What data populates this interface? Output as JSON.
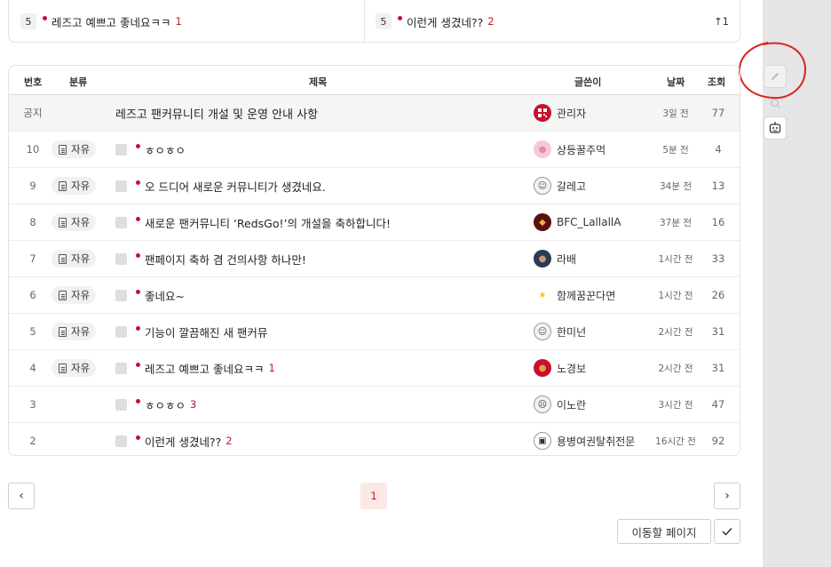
{
  "popular": {
    "left": {
      "rank": "5",
      "title": "레즈고 예쁘고 좋네요ㅋㅋ",
      "comments": "1"
    },
    "right": {
      "rank": "5",
      "title": "이런게 생겼네??",
      "comments": "2",
      "up_icon": "up-arrow-icon",
      "up_count": "↑1"
    }
  },
  "board": {
    "headers": {
      "num": "번호",
      "category": "분류",
      "title": "제목",
      "author": "글쓴이",
      "date": "날짜",
      "views": "조회"
    },
    "notice": {
      "label": "공지",
      "title": "레즈고 팬커뮤니티 개설 및 운영 안내 사항",
      "author": "관리자",
      "date": "3일 전",
      "views": "77"
    },
    "rows": [
      {
        "num": "10",
        "category": "자유",
        "title": "ㅎㅇㅎㅇ",
        "comments": "",
        "author": "상등꿀주먹",
        "date": "5분 전",
        "views": "4"
      },
      {
        "num": "9",
        "category": "자유",
        "title": "오 드디어 새로운 커뮤니티가 생겼네요.",
        "comments": "",
        "author": "갈레고",
        "date": "34분 전",
        "views": "13"
      },
      {
        "num": "8",
        "category": "자유",
        "title": "새로운 팬커뮤니티 ‘RedsGo!’의 개설을 축하합니다!",
        "comments": "",
        "author": "BFC_LallallA",
        "date": "37분 전",
        "views": "16"
      },
      {
        "num": "7",
        "category": "자유",
        "title": "팬페이지 축하 겸 건의사항 하나만!",
        "comments": "",
        "author": "라배",
        "date": "1시간 전",
        "views": "33"
      },
      {
        "num": "6",
        "category": "자유",
        "title": "좋네요~",
        "comments": "",
        "author": "함께꿈꾼다면",
        "date": "1시간 전",
        "views": "26"
      },
      {
        "num": "5",
        "category": "자유",
        "title": "기능이 깔끔해진 새 팬커뮤",
        "comments": "",
        "author": "한미넌",
        "date": "2시간 전",
        "views": "31"
      },
      {
        "num": "4",
        "category": "자유",
        "title": "레즈고 예쁘고 좋네요ㅋㅋ",
        "comments": "1",
        "author": "노경보",
        "date": "2시간 전",
        "views": "31"
      },
      {
        "num": "3",
        "category": "",
        "title": "ㅎㅇㅎㅇ",
        "comments": "3",
        "author": "이노란",
        "date": "3시간 전",
        "views": "47"
      },
      {
        "num": "2",
        "category": "",
        "title": "이런게 생겼네??",
        "comments": "2",
        "author": "용병여권탈취전문",
        "date": "16시간 전",
        "views": "92"
      }
    ]
  },
  "pagination": {
    "prev": "‹",
    "current": "1",
    "next": "›",
    "goto_label": "이동할 페이지",
    "confirm": "✓"
  },
  "rail": {
    "write_icon": "pencil-icon",
    "search_icon": "search-icon",
    "bot_icon": "robot-icon"
  },
  "colors": {
    "accent": "#c8102e",
    "annotation": "#e02020"
  }
}
